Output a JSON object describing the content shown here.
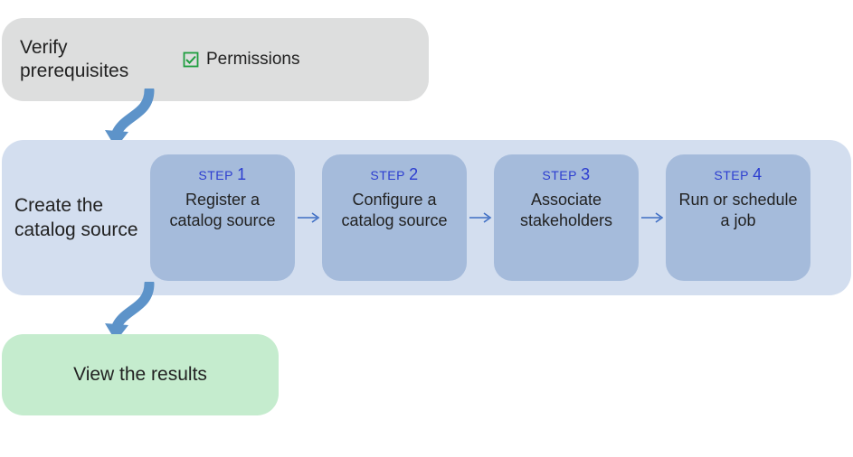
{
  "phases": {
    "verify": {
      "title": "Verify prerequisites",
      "permissions_label": "Permissions"
    },
    "create": {
      "title": "Create the catalog source",
      "step_prefix": "STEP",
      "steps": [
        {
          "num": "1",
          "title": "Register a catalog source"
        },
        {
          "num": "2",
          "title": "Configure a catalog source"
        },
        {
          "num": "3",
          "title": "Associate stakeholders"
        },
        {
          "num": "4",
          "title": "Run or schedule a job"
        }
      ]
    },
    "view": {
      "title": "View the results"
    }
  },
  "colors": {
    "step_label": "#2c3dd0",
    "arrow_big": "#5d93c9",
    "arrow_small": "#406fc4",
    "checkbox": "#1f9e3f"
  }
}
